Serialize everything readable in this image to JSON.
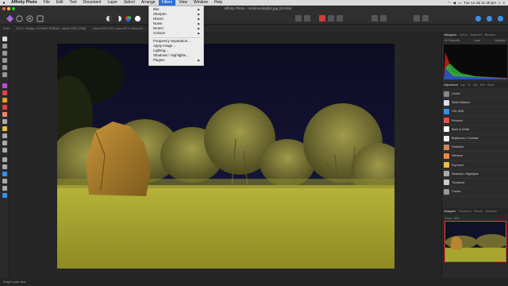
{
  "menubar": {
    "app_name": "Affinity Photo",
    "menus": [
      "File",
      "Edit",
      "Text",
      "Document",
      "Layer",
      "Select",
      "Arrange",
      "Filters",
      "View",
      "Window",
      "Help"
    ],
    "active_menu": "Filters",
    "clock": "Tue 14 Jul  11:49 pm"
  },
  "window": {
    "title": "Affinity Photo - rockmoonlight1.jpg (20.9%)"
  },
  "context": {
    "persona": "Pixel",
    "info": "3473 × 3846px, 19.06MP, RGBA/8 - Adobe RGB (1998)",
    "camera": "Canon EOS 70D Canon EF-S 18mm f/4"
  },
  "filters_menu": {
    "group1": [
      {
        "label": "Blur",
        "submenu": true
      },
      {
        "label": "Sharpen",
        "submenu": true
      },
      {
        "label": "Distort",
        "submenu": true
      },
      {
        "label": "Noise",
        "submenu": true
      },
      {
        "label": "Detect",
        "submenu": true
      },
      {
        "label": "Colours",
        "submenu": true
      }
    ],
    "group2": [
      {
        "label": "Frequency Separation...",
        "submenu": false
      },
      {
        "label": "Apply Image...",
        "submenu": false
      },
      {
        "label": "Lighting...",
        "submenu": false
      },
      {
        "label": "Shadows / Highlights...",
        "submenu": false
      },
      {
        "label": "Plugins",
        "submenu": true
      }
    ]
  },
  "panels": {
    "top_tabs": [
      "Histogram",
      "Colour",
      "Swatches",
      "Brushes"
    ],
    "channel_label": "All Channels",
    "layer_label": "Layer",
    "marquee_label": "Marquee",
    "adjust_tabs": [
      "Adjustment",
      "Lay",
      "Fx",
      "Styl",
      "Hist",
      "Stock"
    ],
    "adjustments": [
      "Levels",
      "White Balance",
      "HSL Shift",
      "Recolour",
      "Black & White",
      "Brightness / Contrast",
      "Posterise",
      "Vibrance",
      "Exposure",
      "Shadows / Highlights",
      "Threshold",
      "Curves"
    ],
    "nav_tabs": [
      "Navigator",
      "Transform",
      "History",
      "Channels"
    ],
    "zoom_label": "Zoom",
    "zoom_value": "20%"
  },
  "status": {
    "text": "Drag to pan view"
  },
  "colors": {
    "accent": "#2f6fd6",
    "panel_bg": "#2c2c2c",
    "night_sky": "#0f0f2e",
    "grass": "#a8a52f"
  }
}
